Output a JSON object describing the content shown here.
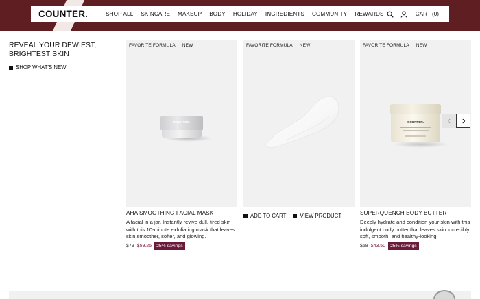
{
  "header": {
    "logo": "COUNTER.",
    "nav_items": [
      "SHOP ALL",
      "SKINCARE",
      "MAKEUP",
      "BODY",
      "HOLIDAY",
      "INGREDIENTS",
      "COMMUNITY",
      "REWARDS"
    ],
    "search_icon": "search-icon",
    "account_icon": "user-icon",
    "cart_label": "CART (0)"
  },
  "promo": {
    "title": "REVEAL YOUR DEWIEST, BRIGHTEST SKIN",
    "link_label": "SHOP WHAT'S NEW"
  },
  "products": [
    {
      "badges": [
        "FAVORITE FORMULA",
        "NEW"
      ],
      "name": "AHA SMOOTHING FACIAL MASK",
      "description": "A facial in a jar. Instantly revive dull, tired skin with this 10-minute exfoliating mask that leaves skin smoother, softer, and glowing.",
      "old_price": "$79",
      "new_price": "$59.25",
      "savings": "25% savings",
      "jar_label": "COUNTER."
    },
    {
      "badges": [
        "FAVORITE FORMULA",
        "NEW"
      ],
      "add_to_cart": "ADD TO CART",
      "view_product": "VIEW PRODUCT"
    },
    {
      "badges": [
        "FAVORITE FORMULA",
        "NEW"
      ],
      "name": "SUPERQUENCH BODY BUTTER",
      "description": "Deeply hydrate and condition your skin with this indulgent body butter that leaves skin incredibly soft, smooth, and healthy-looking.",
      "old_price": "$58",
      "new_price": "$43.50",
      "savings": "25% savings",
      "jar_label": "COUNTER."
    }
  ],
  "carousel": {
    "prev_icon": "chevron-left-icon",
    "next_icon": "chevron-right-icon"
  },
  "colors": {
    "band": "#5e1e22",
    "savings_badge": "#6b1a3a",
    "sale_price": "#7a1e3c"
  }
}
